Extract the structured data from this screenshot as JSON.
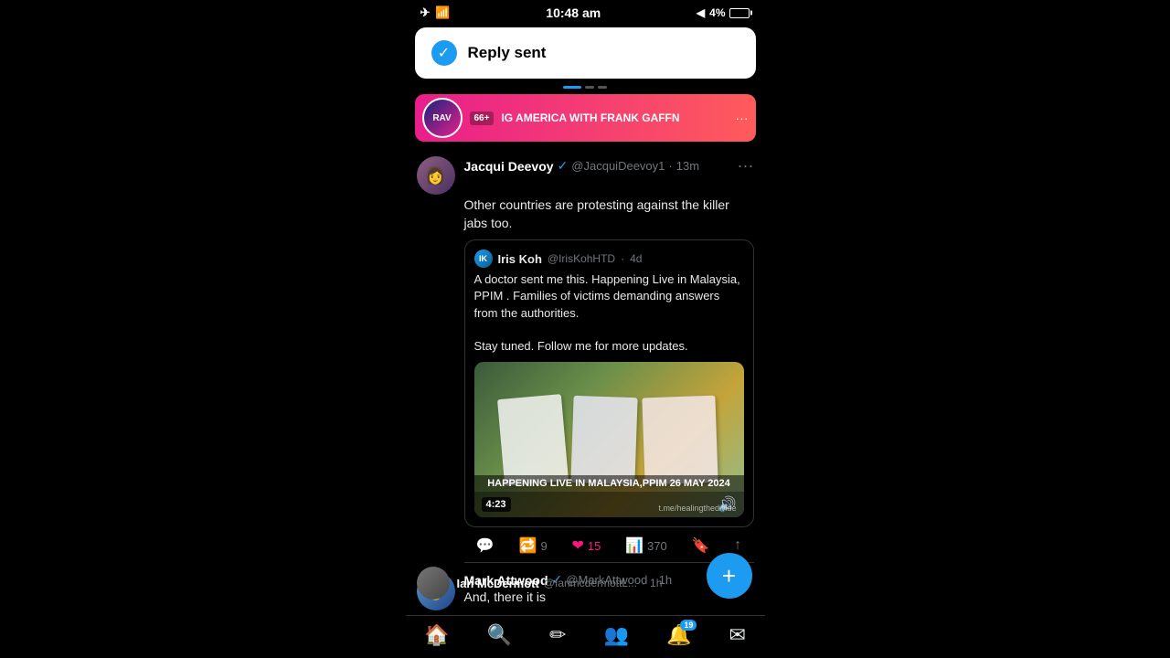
{
  "statusBar": {
    "time": "10:48 am",
    "batteryPercent": "4%"
  },
  "toast": {
    "text": "Reply sent",
    "icon": "✓"
  },
  "liveBanner": {
    "badgeText": "66+",
    "channelText": "IG AMERICA WITH FRANK GAFFN",
    "dots": "···"
  },
  "tweet1": {
    "name": "Jacqui Deevoy",
    "verified": true,
    "handle": "@JacquiDeevoy1",
    "time": "13m",
    "moreIcon": "···",
    "text": "Other countries are protesting against the killer jabs too.",
    "quoteTweet": {
      "authorName": "Iris Koh",
      "authorHandle": "@IrisKohHTD",
      "time": "4d",
      "text": "A doctor sent me this. Happening Live in Malaysia, PPIM . Families of victims demanding answers from the authorities.\n\nStay tuned. Follow me for more updates.",
      "videoOverlay": "HAPPENING LIVE IN MALAYSIA,PPIM 26 MAY 2024",
      "videoDuration": "4:23",
      "videoWatermark": "t.me/healingthedivide"
    },
    "actions": {
      "reply": {
        "icon": "💬",
        "count": ""
      },
      "retweet": {
        "icon": "🔁",
        "count": "9"
      },
      "like": {
        "icon": "❤",
        "count": "15"
      },
      "views": {
        "icon": "📊",
        "count": "370"
      },
      "bookmark": {
        "icon": "🔖",
        "count": ""
      },
      "share": {
        "icon": "↑",
        "count": ""
      }
    }
  },
  "tweet2": {
    "name": "Mark Attwood",
    "verified": true,
    "handle": "@MarkAttwood",
    "time": "1h",
    "text": "And, there it is"
  },
  "footerTweet": {
    "name": "Ian McDermott",
    "handle": "@IanmcdermottL...",
    "time": "1h"
  },
  "nav": {
    "home": "🏠",
    "search": "🔍",
    "write": "✏",
    "people": "👥",
    "notifications": "🔔",
    "notifCount": "19",
    "mail": "✉"
  },
  "fab": {
    "icon": "+"
  }
}
